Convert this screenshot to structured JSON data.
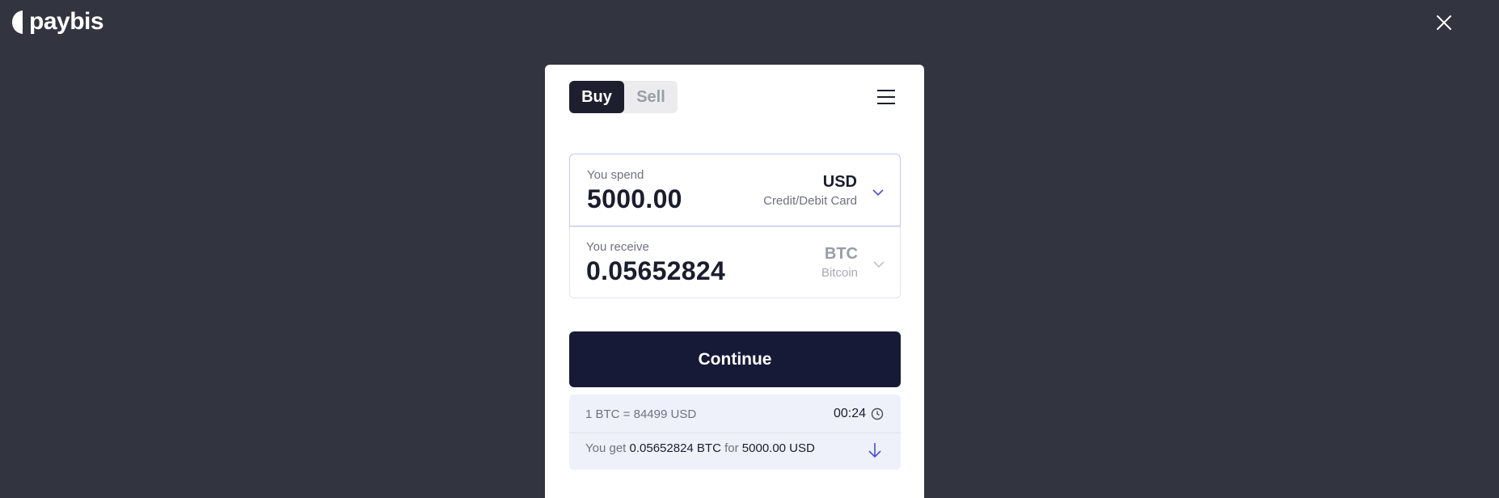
{
  "brand": {
    "name": "paybis"
  },
  "icons": {
    "logo": "paybis-logo-mark",
    "close": "close-icon",
    "menu": "hamburger-menu-icon",
    "chevron": "chevron-down-icon",
    "clock": "clock-icon",
    "arrow_down": "arrow-down-icon"
  },
  "colors": {
    "background": "#323440",
    "primary_button": "#161a36",
    "active_tab": "#1d1f2e",
    "accent": "#4a4fd6"
  },
  "tabs": {
    "buy": "Buy",
    "sell": "Sell",
    "active": "Buy"
  },
  "spend": {
    "label": "You spend",
    "amount": "5000.00",
    "currency_code": "USD",
    "currency_name": "Credit/Debit Card"
  },
  "receive": {
    "label": "You receive",
    "amount": "0.05652824",
    "currency_code": "BTC",
    "currency_name": "Bitcoin"
  },
  "continue_label": "Continue",
  "quote": {
    "rate": "1 BTC = 84499 USD",
    "timer": "00:24",
    "get_prefix": "You get",
    "get_amount": "0.05652824 BTC",
    "get_for": "for",
    "get_total": "5000.00 USD"
  }
}
